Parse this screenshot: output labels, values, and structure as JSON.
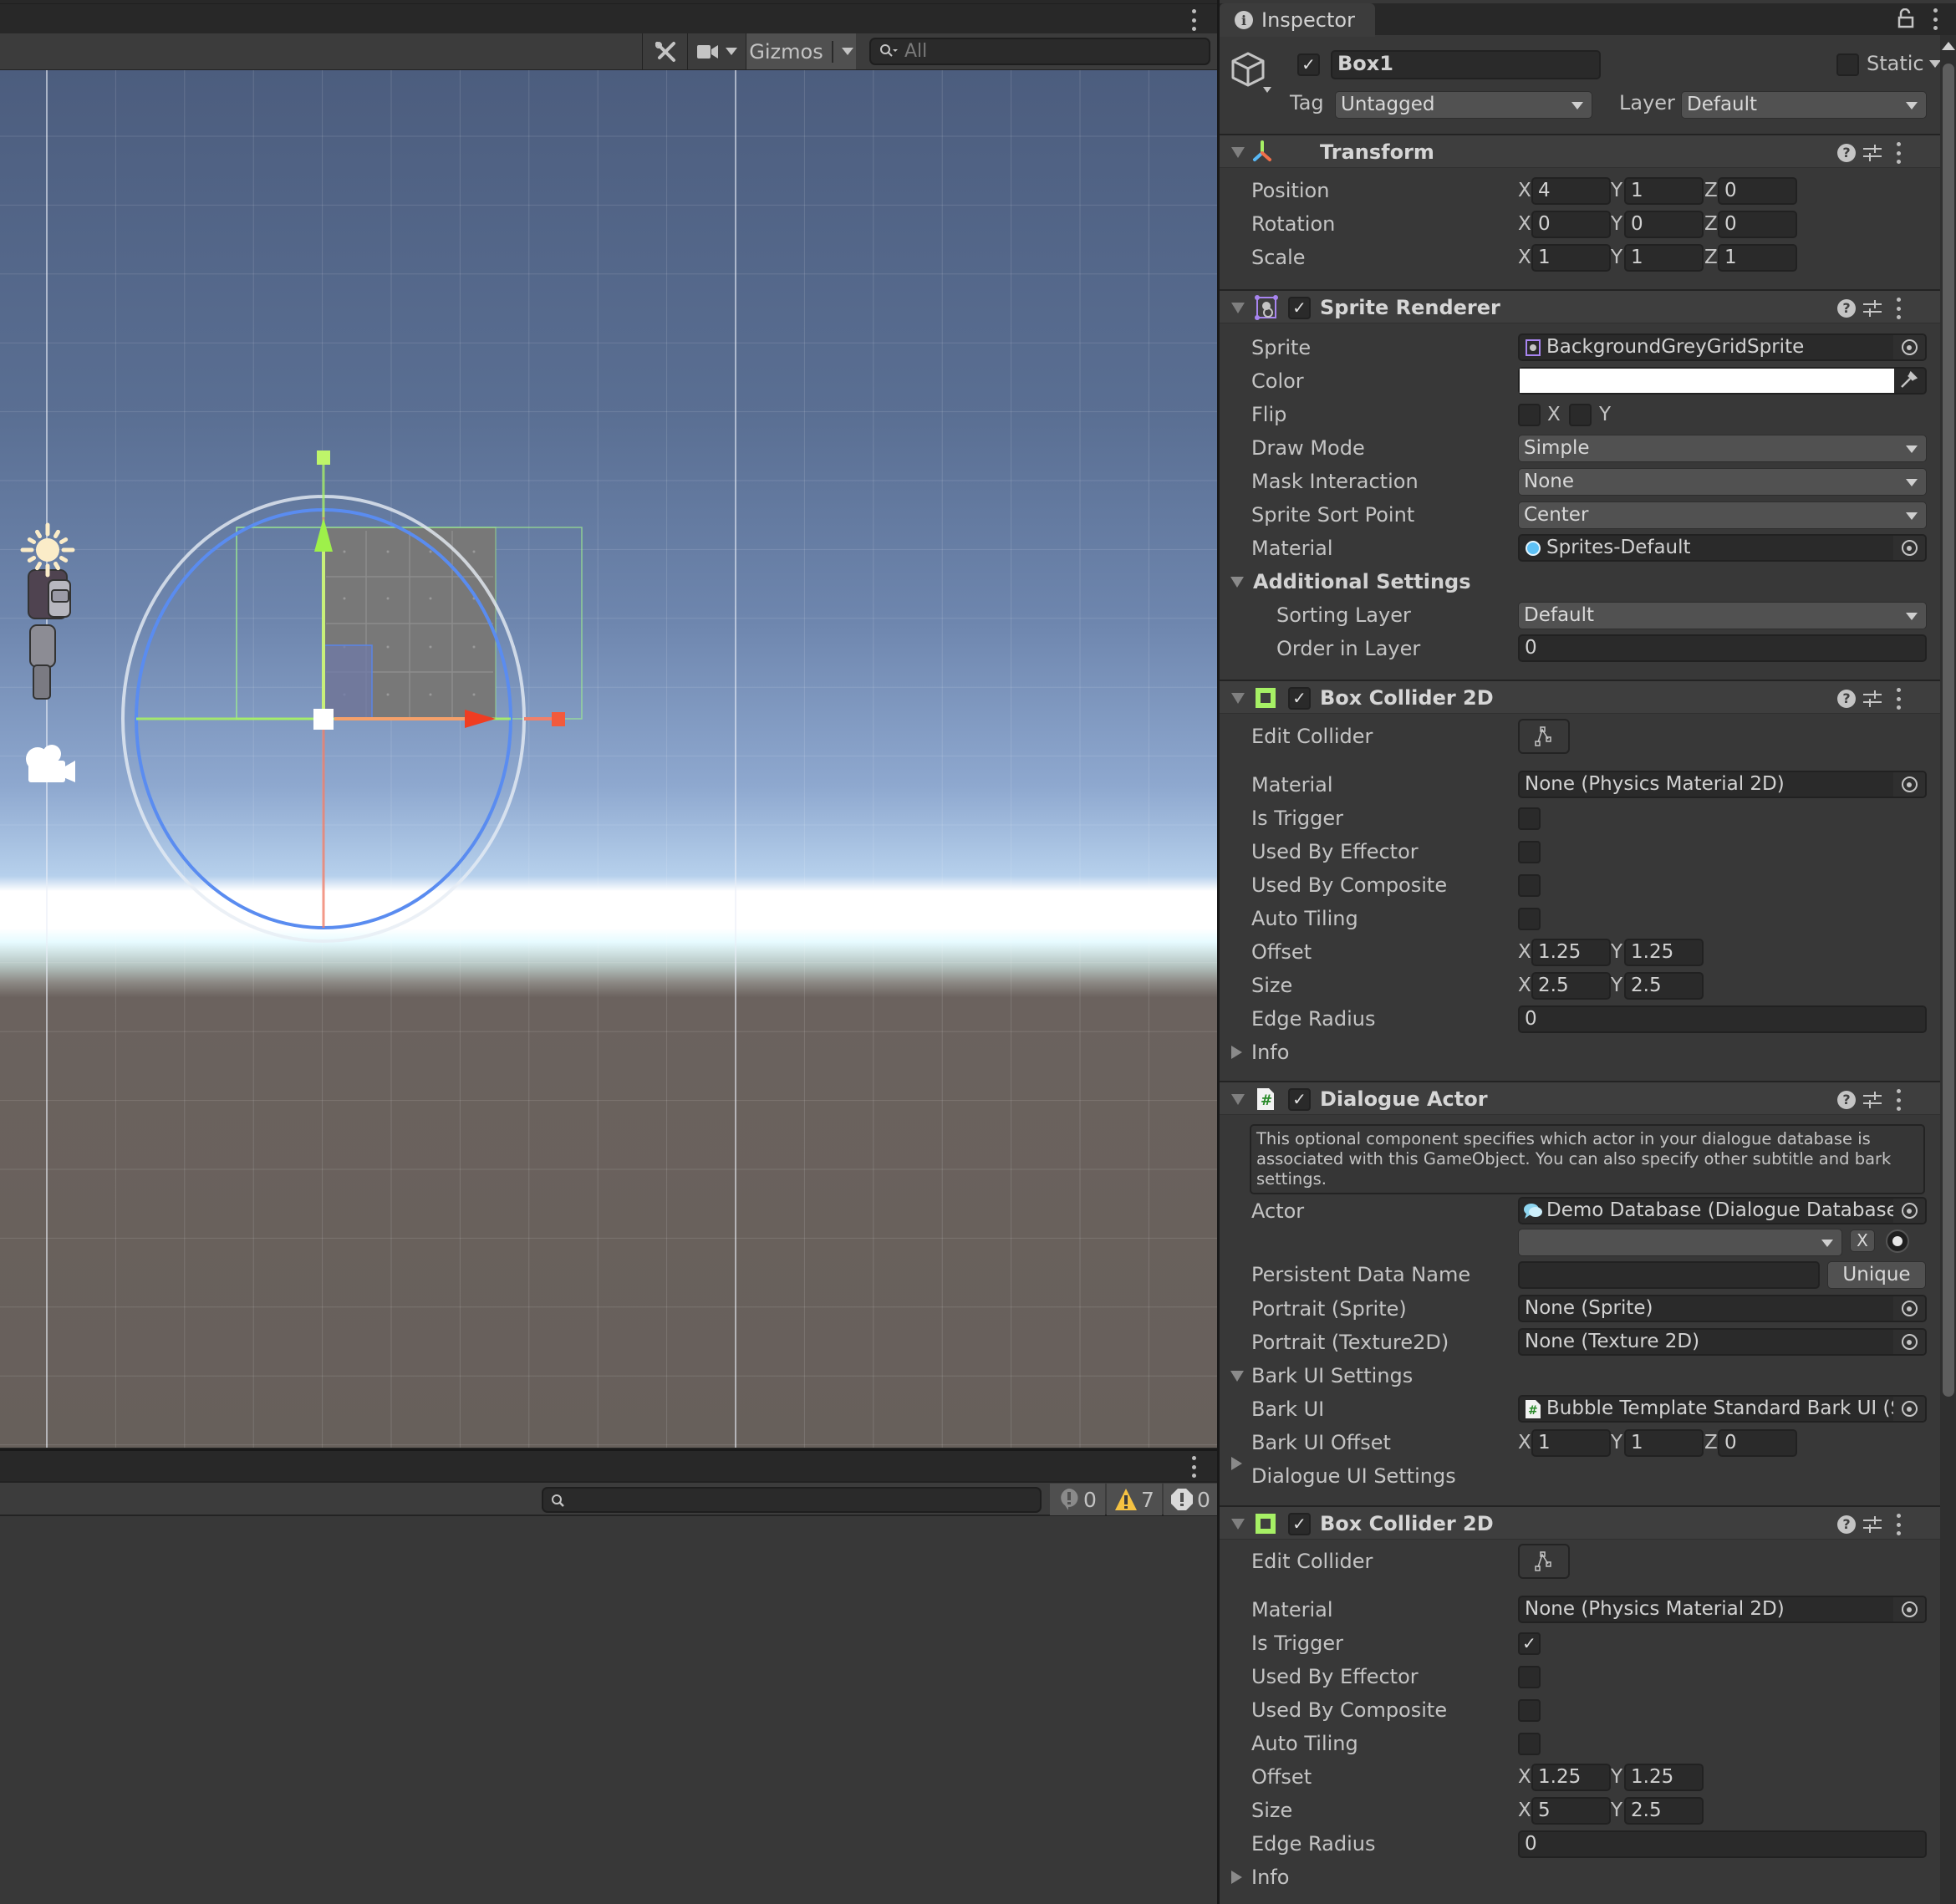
{
  "scene": {
    "toolbar": {
      "tools_icon": "tools-icon",
      "camera_icon": "camera-icon",
      "gizmos_label": "Gizmos",
      "search_placeholder": "All"
    },
    "colors": {
      "x_axis": "#f04d32",
      "y_axis": "#a6f065",
      "z_axis": "#4f8cf5",
      "collider": "#a0f08f"
    }
  },
  "console": {
    "search_placeholder": "",
    "counts": {
      "info": "0",
      "warning": "7",
      "error": "0"
    }
  },
  "inspector": {
    "tab_label": "Inspector",
    "object": {
      "active": true,
      "name": "Box1",
      "static_label": "Static",
      "static_checked": false,
      "tag_label": "Tag",
      "tag_value": "Untagged",
      "layer_label": "Layer",
      "layer_value": "Default"
    },
    "transform": {
      "title": "Transform",
      "rows": [
        {
          "label": "Position",
          "x": "4",
          "y": "1",
          "z": "0"
        },
        {
          "label": "Rotation",
          "x": "0",
          "y": "0",
          "z": "0"
        },
        {
          "label": "Scale",
          "x": "1",
          "y": "1",
          "z": "1"
        }
      ]
    },
    "sprite_renderer": {
      "title": "Sprite Renderer",
      "enabled": true,
      "sprite_label": "Sprite",
      "sprite_value": "BackgroundGreyGridSprite",
      "color_label": "Color",
      "color_value": "#ffffff",
      "flip_label": "Flip",
      "flip_x": "X",
      "flip_y": "Y",
      "draw_mode_label": "Draw Mode",
      "draw_mode_value": "Simple",
      "mask_label": "Mask Interaction",
      "mask_value": "None",
      "sort_point_label": "Sprite Sort Point",
      "sort_point_value": "Center",
      "material_label": "Material",
      "material_value": "Sprites-Default",
      "additional_label": "Additional Settings",
      "sorting_layer_label": "Sorting Layer",
      "sorting_layer_value": "Default",
      "order_label": "Order in Layer",
      "order_value": "0"
    },
    "box_collider_1": {
      "title": "Box Collider 2D",
      "enabled": true,
      "edit_label": "Edit Collider",
      "material_label": "Material",
      "material_value": "None (Physics Material 2D)",
      "is_trigger_label": "Is Trigger",
      "is_trigger": false,
      "effector_label": "Used By Effector",
      "effector": false,
      "composite_label": "Used By Composite",
      "composite": false,
      "auto_tiling_label": "Auto Tiling",
      "auto_tiling": false,
      "offset_label": "Offset",
      "offset_x": "1.25",
      "offset_y": "1.25",
      "size_label": "Size",
      "size_x": "2.5",
      "size_y": "2.5",
      "edge_radius_label": "Edge Radius",
      "edge_radius": "0",
      "info_label": "Info"
    },
    "dialogue_actor": {
      "title": "Dialogue Actor",
      "enabled": true,
      "help_text": "This optional component specifies which actor in your dialogue database is associated with this GameObject. You can also specify other subtitle and bark settings.",
      "actor_label": "Actor",
      "actor_value": "Demo Database (Dialogue Database)",
      "actor_dropdown_value": "",
      "clear_label": "X",
      "persistent_label": "Persistent Data Name",
      "persistent_value": "",
      "unique_label": "Unique",
      "portrait_sprite_label": "Portrait (Sprite)",
      "portrait_sprite_value": "None (Sprite)",
      "portrait_tex_label": "Portrait (Texture2D)",
      "portrait_tex_value": "None (Texture 2D)",
      "bark_settings_label": "Bark UI Settings",
      "bark_ui_label": "Bark UI",
      "bark_ui_value": "Bubble Template Standard Bark UI (S",
      "bark_offset_label": "Bark UI Offset",
      "bark_offset_x": "1",
      "bark_offset_y": "1",
      "bark_offset_z": "0",
      "dialogue_settings_label": "Dialogue UI Settings"
    },
    "box_collider_2": {
      "title": "Box Collider 2D",
      "enabled": true,
      "edit_label": "Edit Collider",
      "material_label": "Material",
      "material_value": "None (Physics Material 2D)",
      "is_trigger_label": "Is Trigger",
      "is_trigger": true,
      "effector_label": "Used By Effector",
      "effector": false,
      "composite_label": "Used By Composite",
      "composite": false,
      "auto_tiling_label": "Auto Tiling",
      "auto_tiling": false,
      "offset_label": "Offset",
      "offset_x": "1.25",
      "offset_y": "1.25",
      "size_label": "Size",
      "size_x": "5",
      "size_y": "2.5",
      "edge_radius_label": "Edge Radius",
      "edge_radius": "0",
      "info_label": "Info"
    },
    "axis_labels": {
      "x": "X",
      "y": "Y",
      "z": "Z"
    }
  }
}
